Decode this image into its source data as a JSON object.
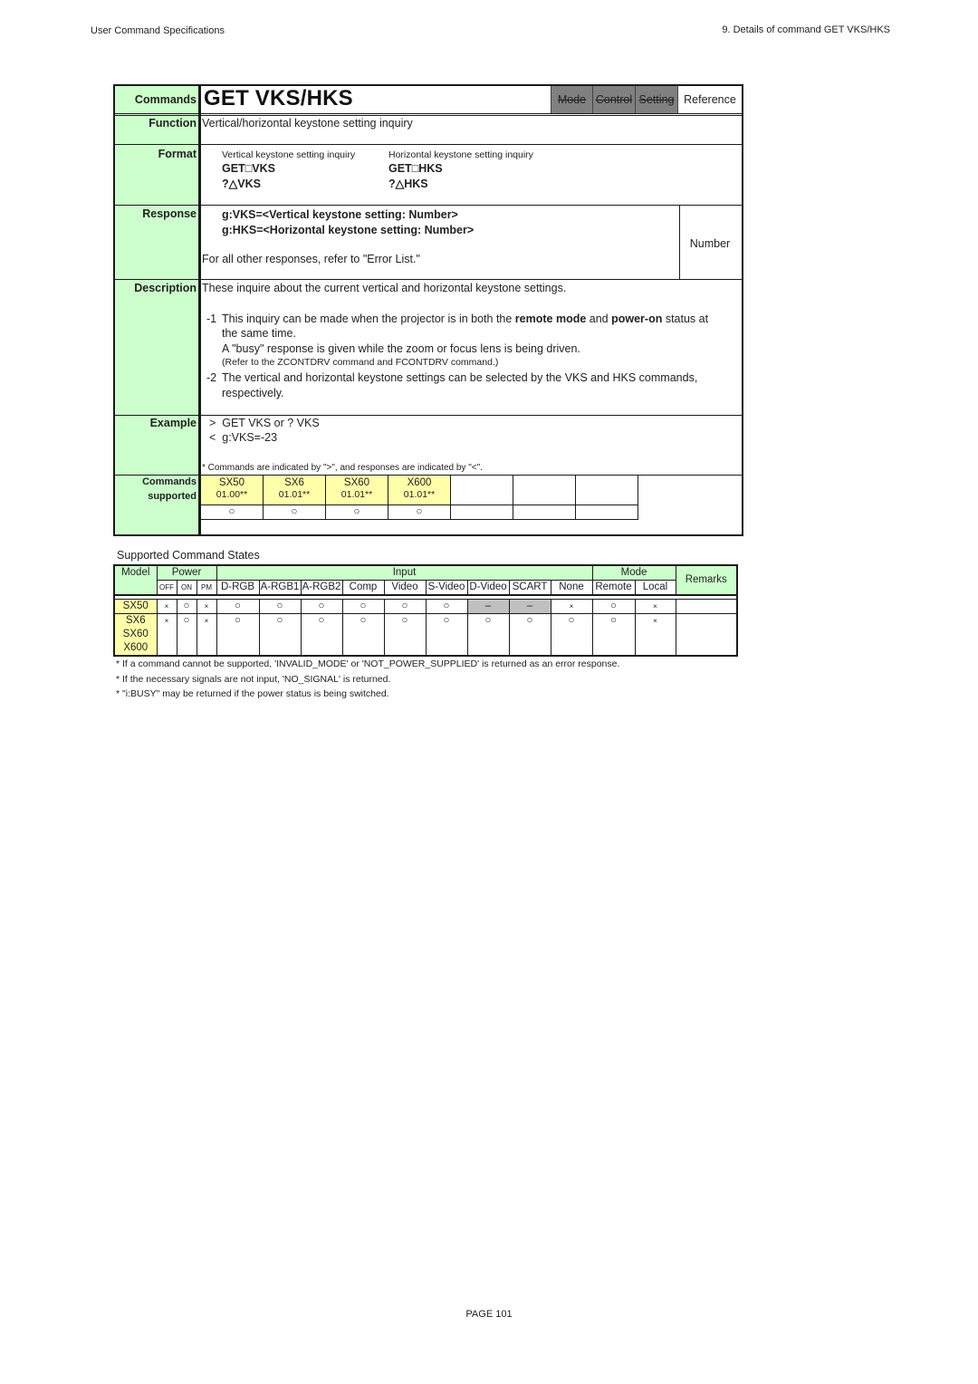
{
  "page_header": {
    "left": "User Command Specifications",
    "right": "9. Details of command  GET VKS/HKS"
  },
  "command": {
    "label": "Commands",
    "name": "GET VKS/HKS",
    "tabs": [
      {
        "label": "Mode",
        "disabled": true
      },
      {
        "label": "Control",
        "disabled": true
      },
      {
        "label": "Setting",
        "disabled": true
      },
      {
        "label": "Reference",
        "disabled": false
      }
    ]
  },
  "function": {
    "label": "Function",
    "text": "Vertical/horizontal keystone setting inquiry"
  },
  "format": {
    "label": "Format",
    "columns": [
      {
        "caption": "Vertical keystone setting inquiry",
        "cmd1": "GET□VKS",
        "cmd2": "?△VKS"
      },
      {
        "caption": "Horizontal keystone setting inquiry",
        "cmd1": "GET□HKS",
        "cmd2": "?△HKS"
      }
    ]
  },
  "response": {
    "label": "Response",
    "lines": [
      "g:VKS=<Vertical keystone setting: Number>",
      "g:HKS=<Horizontal keystone setting: Number>"
    ],
    "note": "For all other responses, refer to \"Error List.\"",
    "type": "Number"
  },
  "description": {
    "label": "Description",
    "intro": "These inquire about the current vertical and horizontal keystone settings.",
    "item1_num": "-1",
    "item1_pre": "This inquiry can be made when the projector is in both the ",
    "item1_b1": "remote mode",
    "item1_mid": " and ",
    "item1_b2": "power-on",
    "item1_post": " status at",
    "item1_line2": "the same time.",
    "item1_line3": "A \"busy\" response is given while the zoom or focus lens is being driven.",
    "item1_line4": "(Refer to the ZCONTDRV command and FCONTDRV command.)",
    "item2_num": "-2",
    "item2_line1": "The vertical and horizontal keystone settings can be selected by the VKS and HKS commands,",
    "item2_line2": "respectively."
  },
  "example": {
    "label": "Example",
    "line1": ">  GET VKS or ? VKS",
    "line2": "<  g:VKS=-23",
    "note": "* Commands are indicated by \">\", and responses are indicated by \"<\"."
  },
  "supported": {
    "label1": "Commands",
    "label2": "supported",
    "models": [
      {
        "model": "SX50",
        "version": "01.00**",
        "mark": "○"
      },
      {
        "model": "SX6",
        "version": "01.01**",
        "mark": "○"
      },
      {
        "model": "SX60",
        "version": "01.01**",
        "mark": "○"
      },
      {
        "model": "X600",
        "version": "01.01**",
        "mark": "○"
      }
    ]
  },
  "states": {
    "title": "Supported Command States",
    "headers": {
      "model": "Model",
      "power": "Power",
      "input": "Input",
      "mode": "Mode",
      "remarks": "Remarks",
      "power_cols": [
        "OFF",
        "ON",
        "PM"
      ],
      "input_cols": [
        "D-RGB",
        "A-RGB1",
        "A-RGB2",
        "Comp",
        "Video",
        "S-Video",
        "D-Video",
        "SCART",
        "None"
      ],
      "mode_cols": [
        "Remote",
        "Local"
      ]
    },
    "rows": [
      {
        "models": [
          "SX50"
        ],
        "values": [
          "×",
          "○",
          "×",
          "○",
          "○",
          "○",
          "○",
          "○",
          "○",
          "–",
          "–",
          "×",
          "○",
          "×"
        ],
        "remarks": ""
      },
      {
        "models": [
          "SX6",
          "SX60",
          "X600"
        ],
        "values": [
          "×",
          "○",
          "×",
          "○",
          "○",
          "○",
          "○",
          "○",
          "○",
          "○",
          "○",
          "○",
          "○",
          "×"
        ],
        "remarks": ""
      }
    ],
    "notes": [
      "* If a command cannot be supported, 'INVALID_MODE' or 'NOT_POWER_SUPPLIED' is returned as an error response.",
      "* If the necessary signals are not input, 'NO_SIGNAL' is returned.",
      "* \"i:BUSY\" may be returned if the power status is being switched."
    ]
  },
  "footer": {
    "page": "PAGE 101"
  }
}
